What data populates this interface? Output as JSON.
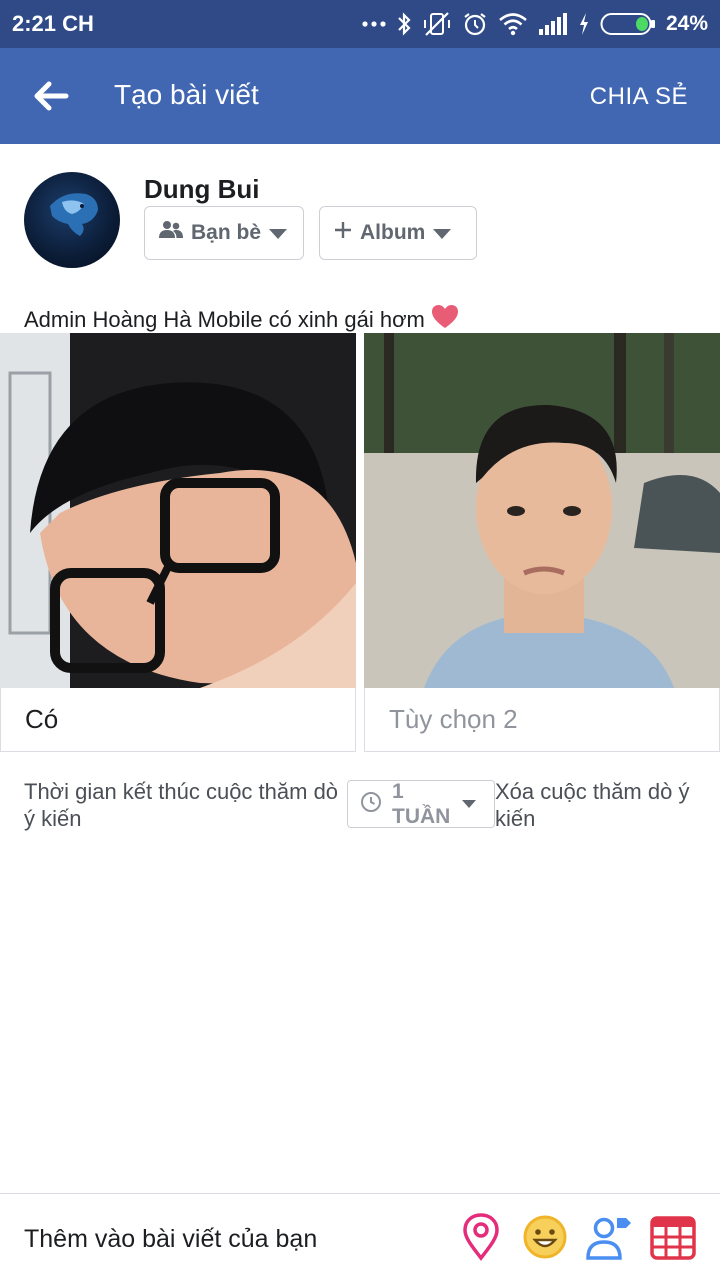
{
  "status_bar": {
    "time": "2:21 CH",
    "battery_percent": "24%",
    "icons": [
      "more-dots-icon",
      "bluetooth-icon",
      "vibrate-off-icon",
      "alarm-icon",
      "wifi-icon",
      "signal-icon",
      "charging-icon",
      "battery-icon"
    ]
  },
  "app_bar": {
    "title": "Tạo bài viết",
    "share_label": "CHIA SẺ"
  },
  "composer": {
    "user_name": "Dung Bui",
    "audience_label": "Bạn bè",
    "album_label": "Album",
    "post_text": "Admin Hoàng Hà Mobile có xinh gái hơm",
    "post_emoji": "heart-icon"
  },
  "poll": {
    "options": [
      {
        "value": "Có",
        "placeholder": ""
      },
      {
        "value": "",
        "placeholder": "Tùy chọn 2"
      }
    ],
    "end_time_label": "Thời gian kết thúc cuộc thăm dò ý kiến",
    "duration_value": "1 TUẦN",
    "remove_label": "Xóa cuộc thăm dò ý kiến"
  },
  "bottom_bar": {
    "label": "Thêm vào bài viết của bạn",
    "icons": [
      "location-pin-icon",
      "feeling-emoji-icon",
      "tag-people-icon",
      "event-calendar-icon"
    ]
  },
  "colors": {
    "status_bar": "#2f4a86",
    "app_bar": "#4267b2",
    "location": "#e52c7a",
    "feeling": "#f5c33b",
    "tag": "#4a8ef2",
    "event": "#e0344b"
  }
}
